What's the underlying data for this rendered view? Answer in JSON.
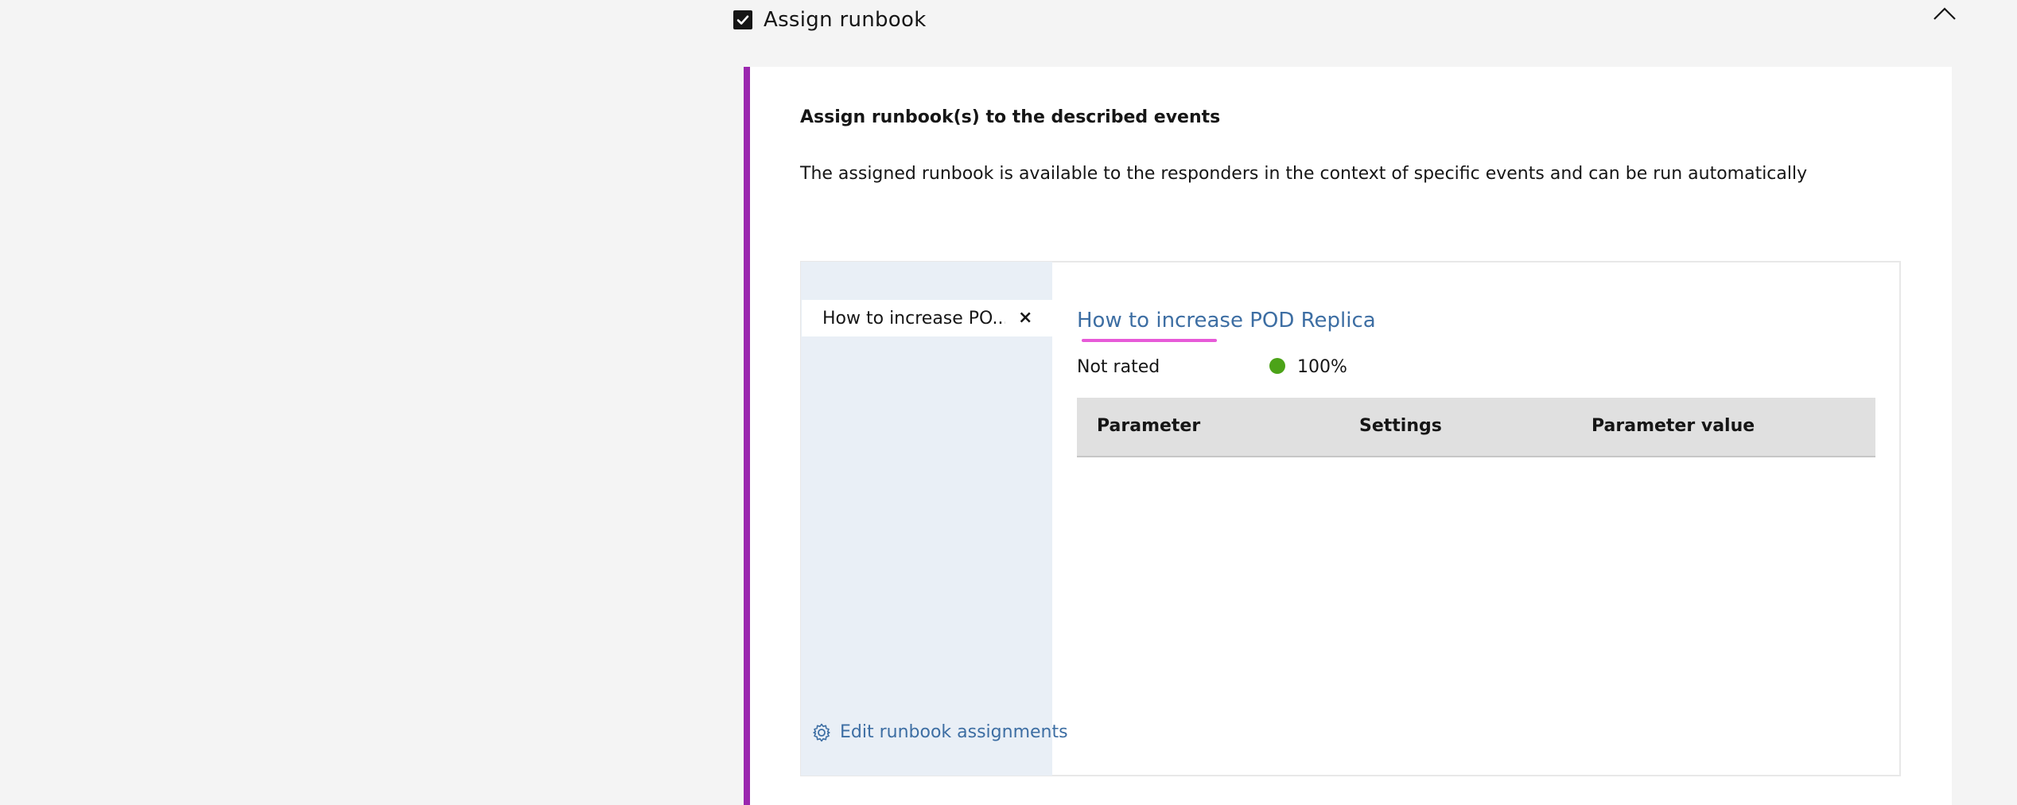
{
  "accordion": {
    "title": "Assign runbook",
    "checked": true
  },
  "panel": {
    "heading": "Assign runbook(s) to the described events",
    "description": "The assigned runbook is available to the responders in the context of specific events and can be run automatically",
    "accent_color": "#9b27af"
  },
  "runbook_list": {
    "items": [
      {
        "label": "How to increase PO...",
        "close": "×"
      }
    ],
    "edit_link": "Edit runbook assignments"
  },
  "runbook_detail": {
    "title": "How to increase POD Replica",
    "rating": "Not rated",
    "success_rate": "100%",
    "status_color": "#4ca318",
    "table": {
      "columns": [
        "Parameter",
        "Settings",
        "Parameter value"
      ]
    }
  }
}
